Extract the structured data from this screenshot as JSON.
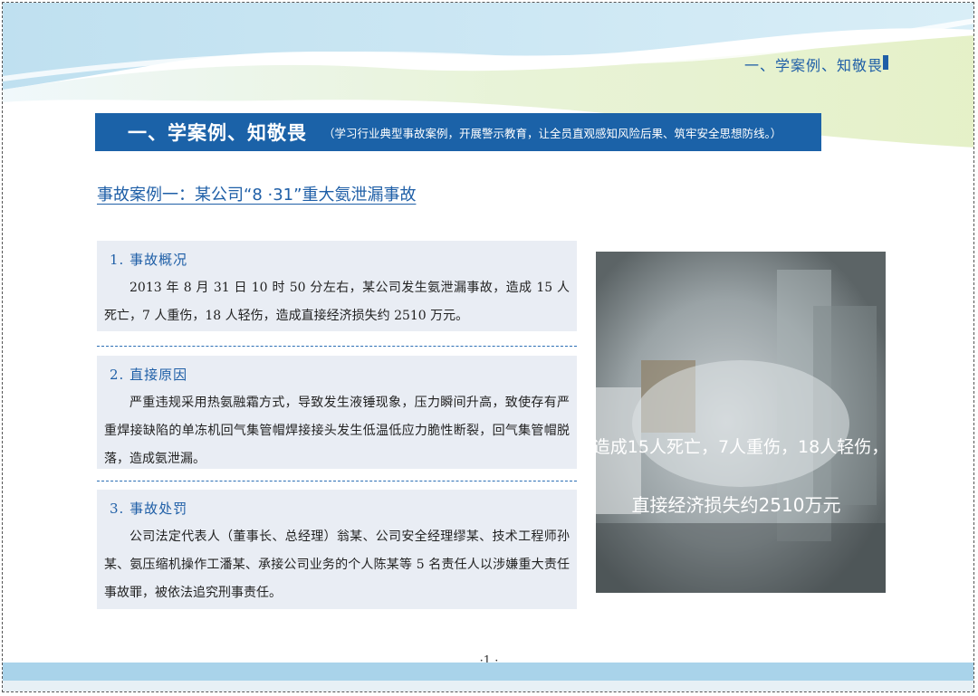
{
  "header": {
    "running_title": "一、学案例、知敬畏"
  },
  "banner": {
    "title": "一、学案例、知敬畏",
    "subtitle": "（学习行业典型事故案例，开展警示教育，让全员直观感知风险后果、筑牢安全思想防线。）"
  },
  "case": {
    "heading": "事故案例一：某公司“8 ·31”重大氨泄漏事故"
  },
  "sections": [
    {
      "title": "1. 事故概况",
      "body": "2013 年 8 月 31 日 10 时 50 分左右，某公司发生氨泄漏事故，造成 15 人死亡，7 人重伤，18 人轻伤，造成直接经济损失约 2510 万元。"
    },
    {
      "title": "2. 直接原因",
      "body": "严重违规采用热氨融霜方式，导致发生液锤现象，压力瞬间升高，致使存有严重焊接缺陷的单冻机回气集管帽焊接接头发生低温低应力脆性断裂，回气集管帽脱落，造成氨泄漏。"
    },
    {
      "title": "3. 事故处罚",
      "body": "公司法定代表人（董事长、总经理）翁某、公司安全经理缪某、技术工程师孙某、氨压缩机操作工潘某、承接公司业务的个人陈某等 5 名责任人以涉嫌重大责任事故罪，被依法追究刑事责任。"
    }
  ],
  "photo": {
    "caption_line1": "造成15人死亡，7人重伤，18人轻伤，",
    "caption_line2": "直接经济损失约2510万元"
  },
  "footer": {
    "page_number": "·1 ·"
  },
  "colors": {
    "accent": "#1b62a8",
    "section_bg": "#e9edf4",
    "wave_light": "#d6ebf5",
    "wave_green": "#e4f0c6"
  }
}
